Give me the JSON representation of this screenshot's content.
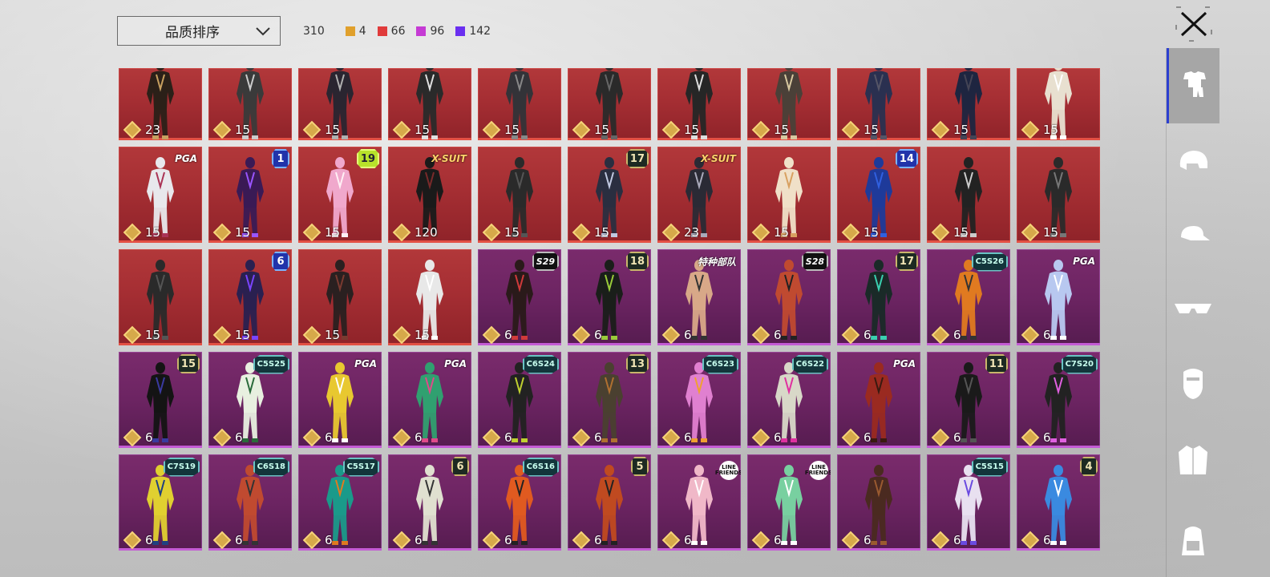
{
  "sort": {
    "label": "品质排序"
  },
  "counts": {
    "total": "310",
    "qualities": [
      {
        "value": "4",
        "color": "#e0a02c"
      },
      {
        "value": "66",
        "color": "#e03b3b"
      },
      {
        "value": "96",
        "color": "#c53bd4"
      },
      {
        "value": "142",
        "color": "#6a2ff0"
      }
    ]
  },
  "tabs": [
    {
      "name": "outfit"
    },
    {
      "name": "helmet"
    },
    {
      "name": "cap"
    },
    {
      "name": "glasses"
    },
    {
      "name": "mask"
    },
    {
      "name": "jacket"
    },
    {
      "name": "backpack"
    }
  ],
  "items": [
    {
      "quality": "red",
      "price": "23",
      "badge": "",
      "style": "",
      "color": "#2b2018",
      "accent": "#c8a060"
    },
    {
      "quality": "red",
      "price": "15",
      "badge": "",
      "style": "",
      "color": "#3a3a3a",
      "accent": "#cccccc"
    },
    {
      "quality": "red",
      "price": "15",
      "badge": "",
      "style": "",
      "color": "#2a2530",
      "accent": "#b0b0b0"
    },
    {
      "quality": "red",
      "price": "15",
      "badge": "",
      "style": "",
      "color": "#2a2a2a",
      "accent": "#e0e0e0"
    },
    {
      "quality": "red",
      "price": "15",
      "badge": "",
      "style": "",
      "color": "#333338",
      "accent": "#888"
    },
    {
      "quality": "red",
      "price": "15",
      "badge": "",
      "style": "",
      "color": "#2a2a2a",
      "accent": "#666"
    },
    {
      "quality": "red",
      "price": "15",
      "badge": "",
      "style": "",
      "color": "#262626",
      "accent": "#ddd"
    },
    {
      "quality": "red",
      "price": "15",
      "badge": "",
      "style": "",
      "color": "#4a4038",
      "accent": "#d8c8a0"
    },
    {
      "quality": "red",
      "price": "15",
      "badge": "",
      "style": "",
      "color": "#2a3050",
      "accent": "#556"
    },
    {
      "quality": "red",
      "price": "15",
      "badge": "",
      "style": "",
      "color": "#1e2540",
      "accent": "#445"
    },
    {
      "quality": "red",
      "price": "15",
      "badge": "",
      "style": "",
      "color": "#e8e0d0",
      "accent": "#fff"
    },
    {
      "quality": "red",
      "price": "15",
      "badge": "PGA",
      "style": "mini",
      "color": "#e8e8ec",
      "accent": "#aa3355"
    },
    {
      "quality": "red",
      "price": "15",
      "badge": "1",
      "style": "blue",
      "color": "#3a1a55",
      "accent": "#9a55ff"
    },
    {
      "quality": "red",
      "price": "15",
      "badge": "19",
      "style": "lime",
      "color": "#f0a8cc",
      "accent": "#fff0f5"
    },
    {
      "quality": "red",
      "price": "120",
      "badge": "X-SUIT",
      "style": "xsuit",
      "color": "#1a1a1a",
      "accent": "#7a2a2a"
    },
    {
      "quality": "red",
      "price": "15",
      "badge": "",
      "style": "",
      "color": "#2a2a2a",
      "accent": "#555"
    },
    {
      "quality": "red",
      "price": "15",
      "badge": "17",
      "style": "",
      "color": "#2a2e40",
      "accent": "#c0c8e0"
    },
    {
      "quality": "red",
      "price": "23",
      "badge": "X-SUIT",
      "style": "xsuit",
      "color": "#2a2a35",
      "accent": "#aab"
    },
    {
      "quality": "red",
      "price": "15",
      "badge": "",
      "style": "",
      "color": "#f0e0c8",
      "accent": "#d8a060"
    },
    {
      "quality": "red",
      "price": "15",
      "badge": "14",
      "style": "blue",
      "color": "#1e3a9a",
      "accent": "#3060e0"
    },
    {
      "quality": "red",
      "price": "15",
      "badge": "",
      "style": "",
      "color": "#222",
      "accent": "#ccc"
    },
    {
      "quality": "red",
      "price": "15",
      "badge": "",
      "style": "",
      "color": "#2a2a2a",
      "accent": "#777"
    },
    {
      "quality": "red",
      "price": "15",
      "badge": "",
      "style": "",
      "color": "#2a2a2a",
      "accent": "#555"
    },
    {
      "quality": "red",
      "price": "15",
      "badge": "6",
      "style": "blue",
      "color": "#2a2050",
      "accent": "#7a44ff"
    },
    {
      "quality": "red",
      "price": "15",
      "badge": "",
      "style": "",
      "color": "#2a2020",
      "accent": "#7a3a30"
    },
    {
      "quality": "red",
      "price": "15",
      "badge": "",
      "style": "",
      "color": "#e8e8e8",
      "accent": "#ffffff"
    },
    {
      "quality": "purple",
      "price": "6",
      "badge": "S29",
      "style": "black",
      "color": "#2a1a1a",
      "accent": "#d03a3a"
    },
    {
      "quality": "purple",
      "price": "6",
      "badge": "18",
      "style": "",
      "color": "#1a1e1a",
      "accent": "#9acc3a"
    },
    {
      "quality": "purple",
      "price": "6",
      "badge": "特种部队",
      "style": "mini",
      "color": "#d8a888",
      "accent": "#333"
    },
    {
      "quality": "purple",
      "price": "6",
      "badge": "S28",
      "style": "black",
      "color": "#c04a30",
      "accent": "#222"
    },
    {
      "quality": "purple",
      "price": "6",
      "badge": "17",
      "style": "",
      "color": "#1a2a28",
      "accent": "#3ad0b0"
    },
    {
      "quality": "purple",
      "price": "6",
      "badge": "C5S26",
      "style": "teal",
      "color": "#e07a20",
      "accent": "#333"
    },
    {
      "quality": "purple",
      "price": "6",
      "badge": "PGA",
      "style": "mini",
      "color": "#b8c8f0",
      "accent": "#fff"
    },
    {
      "quality": "purple",
      "price": "6",
      "badge": "15",
      "style": "",
      "color": "#141414",
      "accent": "#3a3aa0"
    },
    {
      "quality": "purple",
      "price": "6",
      "badge": "C5S25",
      "style": "teal",
      "color": "#e8f0e0",
      "accent": "#2a6a3a"
    },
    {
      "quality": "purple",
      "price": "6",
      "badge": "PGA",
      "style": "mini",
      "color": "#e8c830",
      "accent": "#fff"
    },
    {
      "quality": "purple",
      "price": "6",
      "badge": "PGA",
      "style": "mini",
      "color": "#30a070",
      "accent": "#e04a8a"
    },
    {
      "quality": "purple",
      "price": "6",
      "badge": "C6S24",
      "style": "teal",
      "color": "#222",
      "accent": "#c0d030"
    },
    {
      "quality": "purple",
      "price": "6",
      "badge": "13",
      "style": "",
      "color": "#4a4030",
      "accent": "#b07030"
    },
    {
      "quality": "purple",
      "price": "6",
      "badge": "C6S23",
      "style": "teal",
      "color": "#e080d0",
      "accent": "#f0a030"
    },
    {
      "quality": "purple",
      "price": "6",
      "badge": "C6S22",
      "style": "teal",
      "color": "#d8d8c8",
      "accent": "#e030a0"
    },
    {
      "quality": "purple",
      "price": "6",
      "badge": "PGA",
      "style": "mini",
      "color": "#9a2a20",
      "accent": "#3a1a10"
    },
    {
      "quality": "purple",
      "price": "6",
      "badge": "11",
      "style": "",
      "color": "#1a1a1a",
      "accent": "#555"
    },
    {
      "quality": "purple",
      "price": "6",
      "badge": "C7S20",
      "style": "teal",
      "color": "#222",
      "accent": "#e060e0"
    },
    {
      "quality": "purple",
      "price": "6",
      "badge": "C7S19",
      "style": "teal",
      "color": "#e0d030",
      "accent": "#204080"
    },
    {
      "quality": "purple",
      "price": "6",
      "badge": "C6S18",
      "style": "teal",
      "color": "#c04a30",
      "accent": "#333"
    },
    {
      "quality": "purple",
      "price": "6",
      "badge": "C5S17",
      "style": "teal",
      "color": "#1a9a8a",
      "accent": "#e07a20"
    },
    {
      "quality": "purple",
      "price": "6",
      "badge": "6",
      "style": "",
      "color": "#e0e0d0",
      "accent": "#333"
    },
    {
      "quality": "purple",
      "price": "6",
      "badge": "C6S16",
      "style": "teal",
      "color": "#e05a20",
      "accent": "#222"
    },
    {
      "quality": "purple",
      "price": "6",
      "badge": "5",
      "style": "",
      "color": "#c04a20",
      "accent": "#222"
    },
    {
      "quality": "purple",
      "price": "6",
      "badge": "LINE FRIENDS",
      "style": "line",
      "color": "#f0b8c8",
      "accent": "#fff"
    },
    {
      "quality": "purple",
      "price": "6",
      "badge": "LINE FRIENDS",
      "style": "line",
      "color": "#78d0a0",
      "accent": "#fff"
    },
    {
      "quality": "purple",
      "price": "6",
      "badge": "",
      "style": "",
      "color": "#4a2a20",
      "accent": "#9a5a30"
    },
    {
      "quality": "purple",
      "price": "6",
      "badge": "C5S15",
      "style": "teal",
      "color": "#e8e0f0",
      "accent": "#6a4ae0"
    },
    {
      "quality": "purple",
      "price": "6",
      "badge": "4",
      "style": "",
      "color": "#3a8ae0",
      "accent": "#fff"
    }
  ]
}
